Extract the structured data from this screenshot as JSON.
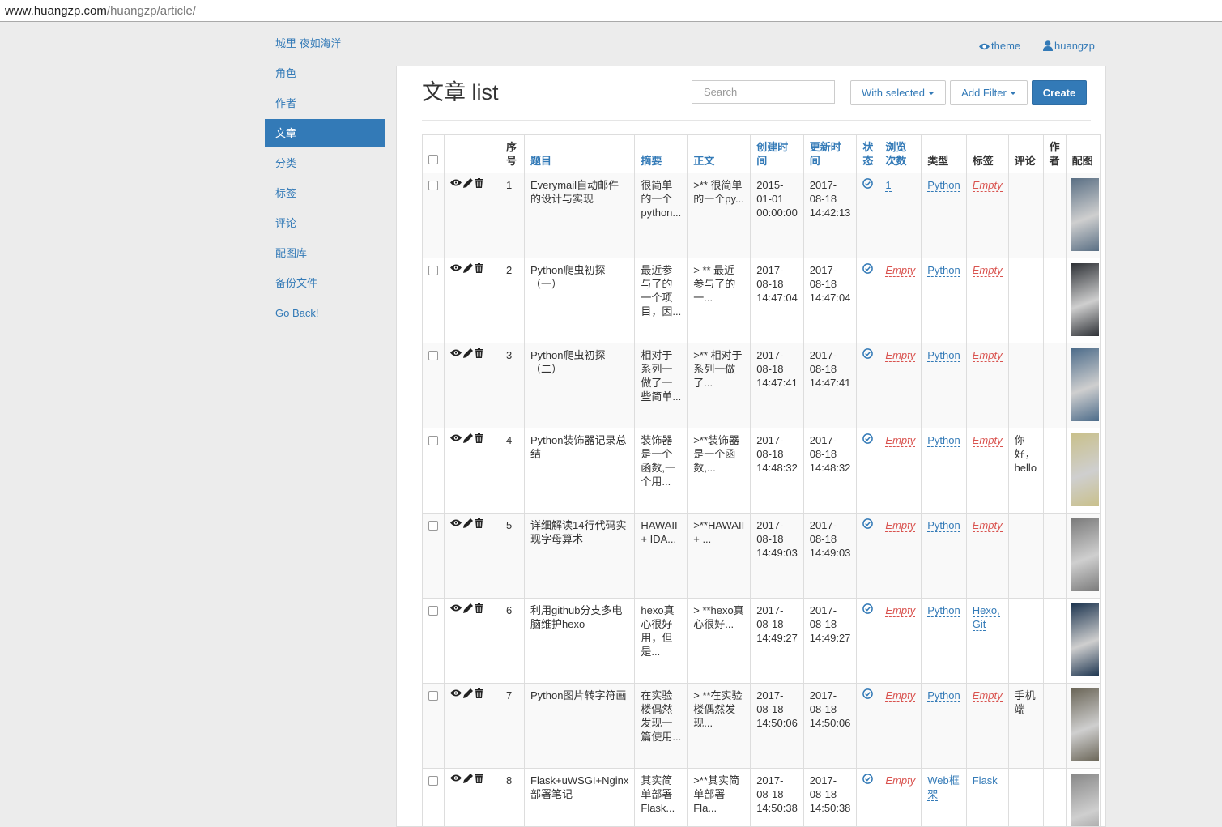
{
  "browser": {
    "url_host": "www.huangzp.com",
    "url_path": "/huangzp/article/"
  },
  "sidebar": {
    "items": [
      {
        "label": "城里 夜如海洋",
        "active": false
      },
      {
        "label": "角色",
        "active": false
      },
      {
        "label": "作者",
        "active": false
      },
      {
        "label": "文章",
        "active": true
      },
      {
        "label": "分类",
        "active": false
      },
      {
        "label": "标签",
        "active": false
      },
      {
        "label": "评论",
        "active": false
      },
      {
        "label": "配图库",
        "active": false
      },
      {
        "label": "备份文件",
        "active": false
      },
      {
        "label": "Go Back!",
        "active": false
      }
    ]
  },
  "header": {
    "theme_label": "theme",
    "user_label": "huangzp"
  },
  "page": {
    "title": "文章 list",
    "search_placeholder": "Search",
    "with_selected": "With selected",
    "add_filter": "Add Filter",
    "create": "Create"
  },
  "table": {
    "headers": [
      "序号",
      "题目",
      "摘要",
      "正文",
      "创建时间",
      "更新时间",
      "状态",
      "浏览次数",
      "类型",
      "标签",
      "评论",
      "作者",
      "配图"
    ],
    "rows": [
      {
        "id": "1",
        "title": "Everymail自动邮件的设计与实现",
        "summary": "很简单的一个python...",
        "body": ">** 很简单的一个py...",
        "created": "2015-01-01 00:00:00",
        "updated": "2017-08-18 14:42:13",
        "views": "1",
        "type": "Python",
        "tags": "Empty",
        "comment": "",
        "img_color": "#5a6f84"
      },
      {
        "id": "2",
        "title": "Python爬虫初探（一）",
        "summary": "最近参与了的一个项目，因...",
        "body": "> ** 最近参与了的一...",
        "created": "2017-08-18 14:47:04",
        "updated": "2017-08-18 14:47:04",
        "views": "Empty",
        "type": "Python",
        "tags": "Empty",
        "comment": "",
        "img_color": "#2e3136"
      },
      {
        "id": "3",
        "title": "Python爬虫初探（二）",
        "summary": "相对于系列一做了一些简单...",
        "body": ">** 相对于系列一做了...",
        "created": "2017-08-18 14:47:41",
        "updated": "2017-08-18 14:47:41",
        "views": "Empty",
        "type": "Python",
        "tags": "Empty",
        "comment": "",
        "img_color": "#4d6c8a"
      },
      {
        "id": "4",
        "title": "Python装饰器记录总结",
        "summary": "装饰器是一个函数,一个用...",
        "body": ">**装饰器是一个函数,...",
        "created": "2017-08-18 14:48:32",
        "updated": "2017-08-18 14:48:32",
        "views": "Empty",
        "type": "Python",
        "tags": "Empty",
        "comment": "你好，hello",
        "img_color": "#c9c08b"
      },
      {
        "id": "5",
        "title": "详细解读14行代码实现字母算术",
        "summary": "HAWAII + IDA...",
        "body": ">**HAWAII + ...",
        "created": "2017-08-18 14:49:03",
        "updated": "2017-08-18 14:49:03",
        "views": "Empty",
        "type": "Python",
        "tags": "Empty",
        "comment": "",
        "img_color": "#7b7b7b"
      },
      {
        "id": "6",
        "title": "利用github分支多电脑维护hexo",
        "summary": "hexo真心很好用，但是...",
        "body": "> **hexo真心很好...",
        "created": "2017-08-18 14:49:27",
        "updated": "2017-08-18 14:49:27",
        "views": "Empty",
        "type": "Python",
        "tags": "Hexo, Git",
        "comment": "",
        "img_color": "#1d3550"
      },
      {
        "id": "7",
        "title": "Python图片转字符画",
        "summary": "在实验楼偶然发现一篇使用...",
        "body": "> **在实验楼偶然发现...",
        "created": "2017-08-18 14:50:06",
        "updated": "2017-08-18 14:50:06",
        "views": "Empty",
        "type": "Python",
        "tags": "Empty",
        "comment": "手机端",
        "img_color": "#6b6658"
      },
      {
        "id": "8",
        "title": "Flask+uWSGI+Nginx部署笔记",
        "summary": "其实简单部署Flask...",
        "body": ">**其实简单部署Fla...",
        "created": "2017-08-18 14:50:38",
        "updated": "2017-08-18 14:50:38",
        "views": "Empty",
        "type": "Web框架",
        "tags": "Flask",
        "comment": "",
        "img_color": "#888888"
      }
    ]
  }
}
